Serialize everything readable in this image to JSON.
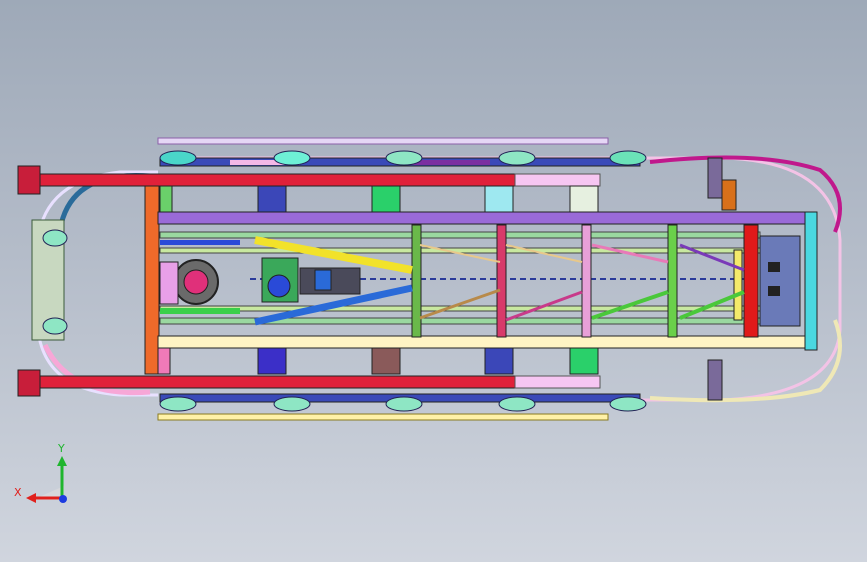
{
  "viewport": {
    "background_top": "#9ea9b8",
    "background_bottom": "#d0d5de"
  },
  "triad": {
    "x_label": "X",
    "y_label": "Y",
    "x_color": "#e0201c",
    "y_color": "#1fb52e",
    "z_color": "#1c3be0"
  },
  "model": {
    "icons": [
      "cad-assembly-icon",
      "coordinate-triad-icon"
    ]
  }
}
